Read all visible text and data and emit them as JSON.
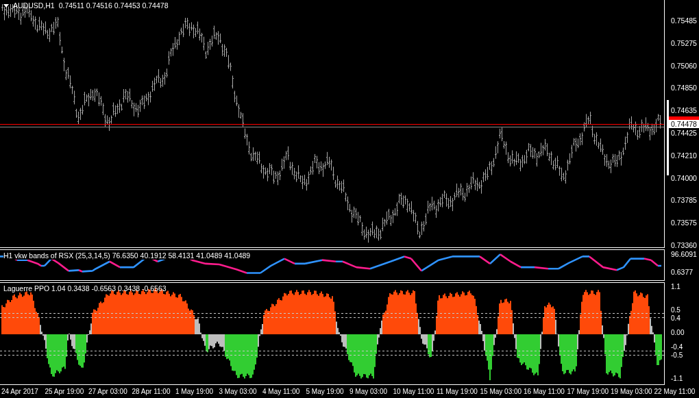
{
  "main_chart": {
    "symbol": "AUDUSD,H1",
    "ohlc": "0.74511 0.74516 0.74453 0.74478",
    "price_axis": [
      "0.75485",
      "0.75275",
      "0.75060",
      "0.74850",
      "0.74635",
      "0.74425",
      "0.74210",
      "0.74000",
      "0.73785",
      "0.73575",
      "0.73360"
    ],
    "current_price": "0.74478"
  },
  "rsx_panel": {
    "title": "H1 vkw bands of RSX (25,3,14,5) 76.6350 40.1912 58.4131 41.0489 41.0489",
    "axis": [
      "96.6091",
      "0.6377"
    ]
  },
  "ppo_panel": {
    "title": "Laguerre PPO 1.04 0.3438 -0.6563 0.3438 -0.6563",
    "axis": [
      "1.1",
      "0.5",
      "0.4",
      "0.00",
      "-0.4",
      "-0.5",
      "-1.1"
    ]
  },
  "time_axis": [
    "24 Apr 2017",
    "25 Apr 19:00",
    "27 Apr 03:00",
    "28 Apr 11:00",
    "1 May 19:00",
    "3 May 03:00",
    "4 May 11:00",
    "5 May 19:00",
    "9 May 03:00",
    "10 May 11:00",
    "11 May 19:00",
    "15 May 03:00",
    "16 May 11:00",
    "17 May 19:00",
    "19 May 03:00",
    "22 May 11:00"
  ]
}
